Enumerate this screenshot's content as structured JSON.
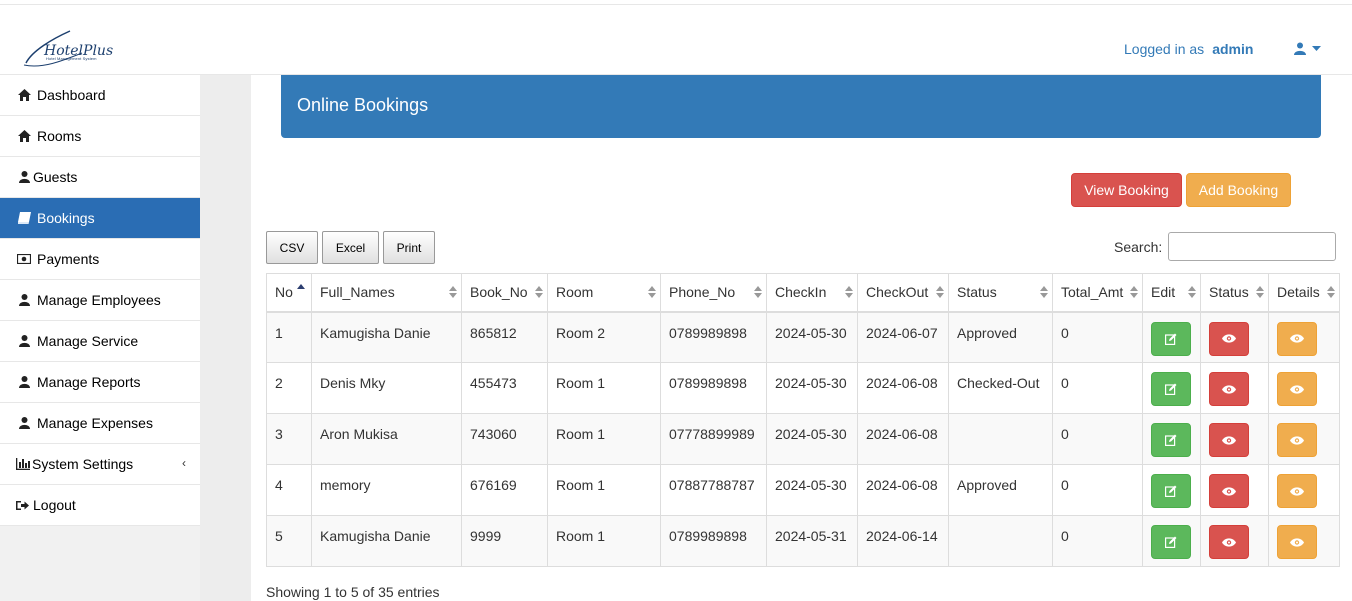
{
  "brand": {
    "logo_text": "HotelPlus",
    "logo_sub": "Hotel Management System"
  },
  "navbar": {
    "logged_in_prefix": "Logged in as",
    "username": "admin"
  },
  "sidebar": {
    "items": [
      {
        "label": "Dashboard",
        "icon": "home-icon"
      },
      {
        "label": "Rooms",
        "icon": "home-icon"
      },
      {
        "label": "Guests",
        "icon": "user-icon"
      },
      {
        "label": "Bookings",
        "icon": "book-icon"
      },
      {
        "label": "Payments",
        "icon": "money-icon"
      },
      {
        "label": "Manage Employees",
        "icon": "user-icon"
      },
      {
        "label": "Manage Service",
        "icon": "user-icon"
      },
      {
        "label": "Manage Reports",
        "icon": "user-icon"
      },
      {
        "label": "Manage Expenses",
        "icon": "user-icon"
      },
      {
        "label": "System Settings",
        "icon": "bar-chart-icon"
      },
      {
        "label": "Logout",
        "icon": "sign-out-icon"
      }
    ],
    "active": "Bookings"
  },
  "panel": {
    "title": "Online Bookings"
  },
  "actions": {
    "view_booking": "View Booking",
    "add_booking": "Add Booking"
  },
  "export": {
    "csv": "CSV",
    "excel": "Excel",
    "print": "Print"
  },
  "search": {
    "label": "Search:",
    "value": ""
  },
  "table": {
    "columns": [
      "No",
      "Full_Names",
      "Book_No",
      "Room",
      "Phone_No",
      "CheckIn",
      "CheckOut",
      "Status",
      "Total_Amt",
      "Edit",
      "Status",
      "Details"
    ],
    "rows": [
      {
        "no": "1",
        "name": "Kamugisha Danie",
        "book_no": "865812",
        "room": "Room 2",
        "phone": "0789989898",
        "checkin": "2024-05-30",
        "checkout": "2024-06-07",
        "status": "Approved",
        "total": "0"
      },
      {
        "no": "2",
        "name": "Denis Mky",
        "book_no": "455473",
        "room": "Room 1",
        "phone": "0789989898",
        "checkin": "2024-05-30",
        "checkout": "2024-06-08",
        "status": "Checked-Out",
        "total": "0"
      },
      {
        "no": "3",
        "name": "Aron Mukisa",
        "book_no": "743060",
        "room": "Room 1",
        "phone": "07778899989",
        "checkin": "2024-05-30",
        "checkout": "2024-06-08",
        "status": "",
        "total": "0"
      },
      {
        "no": "4",
        "name": "memory",
        "book_no": "676169",
        "room": "Room 1",
        "phone": "07887788787",
        "checkin": "2024-05-30",
        "checkout": "2024-06-08",
        "status": "Approved",
        "total": "0"
      },
      {
        "no": "5",
        "name": "Kamugisha Danie",
        "book_no": "9999",
        "room": "Room 1",
        "phone": "0789989898",
        "checkin": "2024-05-31",
        "checkout": "2024-06-14",
        "status": "",
        "total": "0"
      }
    ]
  },
  "footer_info": "Showing 1 to 5 of 35 entries",
  "colors": {
    "primary": "#337ab7",
    "active_nav": "#2a6db4",
    "success": "#5cb85c",
    "danger": "#d9534f",
    "warning": "#f0ad4e"
  }
}
